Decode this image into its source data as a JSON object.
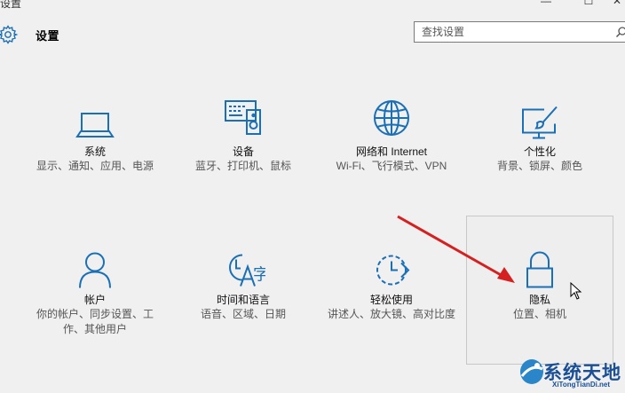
{
  "window": {
    "title": "设置"
  },
  "header": {
    "title": "设置"
  },
  "search": {
    "placeholder": "查找设置"
  },
  "accent_color": "#1a6fb5",
  "tiles": [
    {
      "icon": "laptop-icon",
      "title": "系统",
      "desc": "显示、通知、应用、电源"
    },
    {
      "icon": "devices-icon",
      "title": "设备",
      "desc": "蓝牙、打印机、鼠标"
    },
    {
      "icon": "globe-icon",
      "title": "网络和 Internet",
      "desc": "Wi-Fi、飞行模式、VPN"
    },
    {
      "icon": "personalization-icon",
      "title": "个性化",
      "desc": "背景、锁屏、颜色"
    },
    {
      "icon": "person-icon",
      "title": "帐户",
      "desc": "你的帐户、同步设置、工作、其他用户"
    },
    {
      "icon": "time-language-icon",
      "title": "时间和语言",
      "desc": "语音、区域、日期"
    },
    {
      "icon": "ease-of-access-icon",
      "title": "轻松使用",
      "desc": "讲述人、放大镜、高对比度"
    },
    {
      "icon": "lock-icon",
      "title": "隐私",
      "desc": "位置、相机"
    }
  ],
  "annotation": {
    "arrow_color": "#d42020"
  },
  "watermark": {
    "text": "系统天地",
    "url": "XiTongTianDi.net"
  }
}
